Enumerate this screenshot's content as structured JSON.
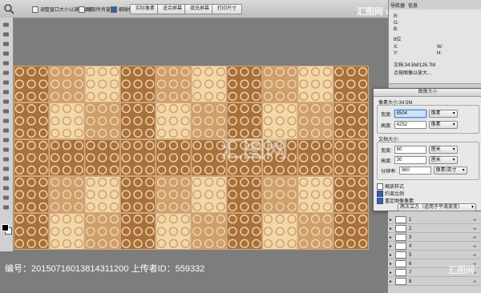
{
  "options_bar": {
    "resize_windows_label": "调整窗口大小以满屏显示",
    "zoom_all_label": "缩放所有窗口",
    "scrubby_zoom_label": "细微缩放",
    "btn_actual": "实际像素",
    "btn_fit": "适合屏幕",
    "btn_fill": "填充屏幕",
    "btn_print": "打印尺寸",
    "zoom_icon": "zoom-tool-icon",
    "scrubby_checked": true
  },
  "info_panel": {
    "tab_nav": "导航器",
    "tab_info": "信息",
    "r_label": "R:",
    "g_label": "G:",
    "b_label": "B:",
    "bit_label": "8位",
    "x_label": "X:",
    "y_label": "Y:",
    "w_label": "W:",
    "h_label": "H:",
    "doc_size": "文档:34.5M/126.7M",
    "hint": "点按图像以放大..."
  },
  "dialog": {
    "title": "图像大小",
    "pixel_dimensions": "像素大小:34.5M",
    "width_label": "宽度:",
    "width_value": "8504",
    "width_unit": "像素",
    "height_label": "高度:",
    "height_value": "4252",
    "height_unit": "像素",
    "doc_size_label": "文档大小:",
    "doc_width_label": "宽度:",
    "doc_width_value": "60",
    "doc_width_unit": "厘米",
    "doc_height_label": "高度:",
    "doc_height_value": "30",
    "doc_height_unit": "厘米",
    "resolution_label": "分辨率:",
    "resolution_value": "360",
    "resolution_unit": "像素/英寸",
    "scale_styles": "缩放样式",
    "constrain": "约束比例",
    "resample": "重定图像像素:",
    "resample_method": "两次立方（适用于平滑渐变）",
    "scale_checked": false,
    "constrain_checked": true,
    "resample_checked": true
  },
  "layers": {
    "rows": [
      "1",
      "2",
      "3",
      "4",
      "5",
      "6",
      "7",
      "8"
    ]
  },
  "watermarks": {
    "top": "汇图网 www.huitu.com",
    "center": "汇图网"
  },
  "footer": {
    "id_text": "编号：20150716013814311200 上传者ID：559332",
    "logo_text": "汇图网"
  },
  "colors": {
    "tile_dark": "#a8703c",
    "tile_mid": "#cf9e6d",
    "tile_light": "#f2d7a8",
    "canvas_bg": "#d2a57d",
    "accent": "#3a5fa8"
  }
}
